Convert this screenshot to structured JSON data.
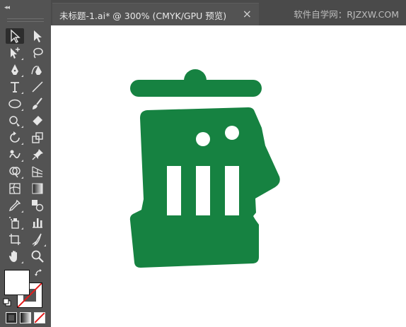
{
  "document_tab": {
    "title": "未标题-1.ai* @ 300% (CMYK/GPU 预览)",
    "close_label": "×"
  },
  "watermark": "软件自学网：RJZXW.COM",
  "toolbar": {
    "collapse_label": "◂◂",
    "tools": [
      {
        "name": "selection-tool",
        "icon": "selection-arrow"
      },
      {
        "name": "direct-selection-tool",
        "icon": "direct-selection-arrow"
      },
      {
        "name": "magic-wand-tool",
        "icon": "magic-wand"
      },
      {
        "name": "lasso-tool",
        "icon": "lasso"
      },
      {
        "name": "pen-tool",
        "icon": "pen"
      },
      {
        "name": "curvature-tool",
        "icon": "curvature-pen"
      },
      {
        "name": "type-tool",
        "icon": "type-T"
      },
      {
        "name": "line-segment-tool",
        "icon": "line"
      },
      {
        "name": "ellipse-tool",
        "icon": "ellipse"
      },
      {
        "name": "paintbrush-tool",
        "icon": "brush"
      },
      {
        "name": "shaper-tool",
        "icon": "shaper"
      },
      {
        "name": "eraser-tool",
        "icon": "eraser"
      },
      {
        "name": "rotate-tool",
        "icon": "rotate"
      },
      {
        "name": "scale-tool",
        "icon": "scale"
      },
      {
        "name": "warp-tool",
        "icon": "warp"
      },
      {
        "name": "puppet-warp-tool",
        "icon": "pin"
      },
      {
        "name": "shape-builder-tool",
        "icon": "shape-builder"
      },
      {
        "name": "perspective-grid-tool",
        "icon": "perspective"
      },
      {
        "name": "mesh-tool",
        "icon": "mesh"
      },
      {
        "name": "gradient-tool",
        "icon": "gradient"
      },
      {
        "name": "eyedropper-tool",
        "icon": "eyedropper"
      },
      {
        "name": "blend-tool",
        "icon": "blend"
      },
      {
        "name": "symbol-sprayer-tool",
        "icon": "sprayer"
      },
      {
        "name": "column-graph-tool",
        "icon": "graph"
      },
      {
        "name": "artboard-tool",
        "icon": "artboard"
      },
      {
        "name": "slice-tool",
        "icon": "slice"
      },
      {
        "name": "hand-tool",
        "icon": "hand"
      },
      {
        "name": "zoom-tool",
        "icon": "magnifier"
      }
    ]
  },
  "colors": {
    "artwork_green": "#168241",
    "fill": "#ffffff",
    "stroke": "none",
    "ui_dark": "#535353",
    "canvas": "#ffffff"
  }
}
